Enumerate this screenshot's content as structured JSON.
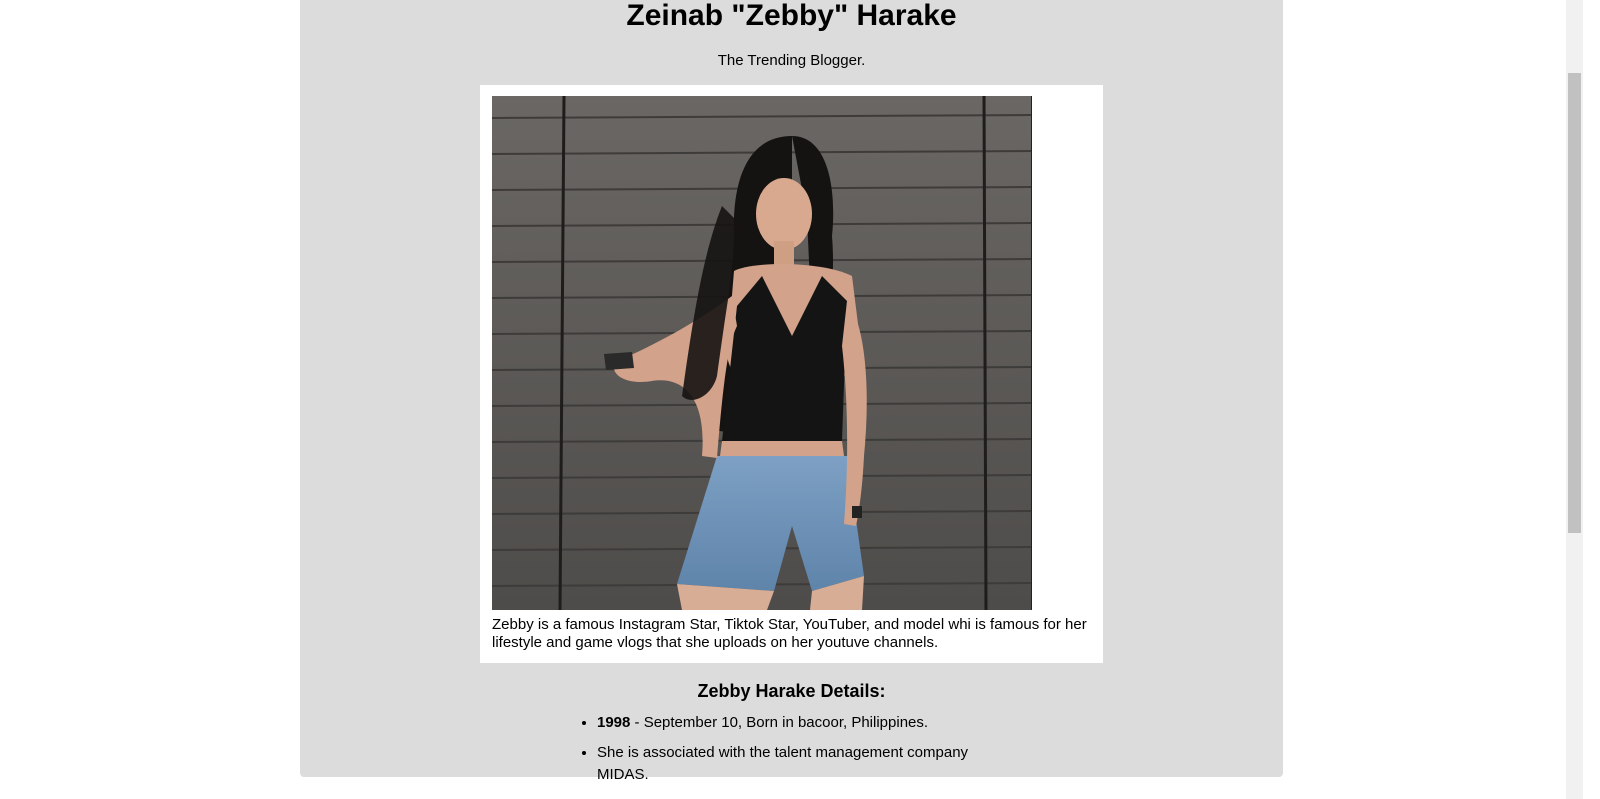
{
  "profile": {
    "title": "Zeinab \"Zebby\" Harake",
    "tagline": "The Trending Blogger.",
    "image_alt": "Zebby Harake",
    "caption": "Zebby is a famous Instagram Star, Tiktok Star, YouTuber, and model whi is famous for her lifestyle and game vlogs that she uploads on her youtuve channels."
  },
  "details": {
    "heading": "Zebby Harake Details:",
    "items": [
      {
        "year": "1998",
        "text": " - September 10, Born in bacoor, Philippines."
      },
      {
        "year": "",
        "text": "She is associated with the talent management company MIDAS."
      }
    ]
  },
  "colors": {
    "page_background": "#ffffff",
    "main_panel": "#dcdcdc",
    "figure_background": "#ffffff"
  }
}
